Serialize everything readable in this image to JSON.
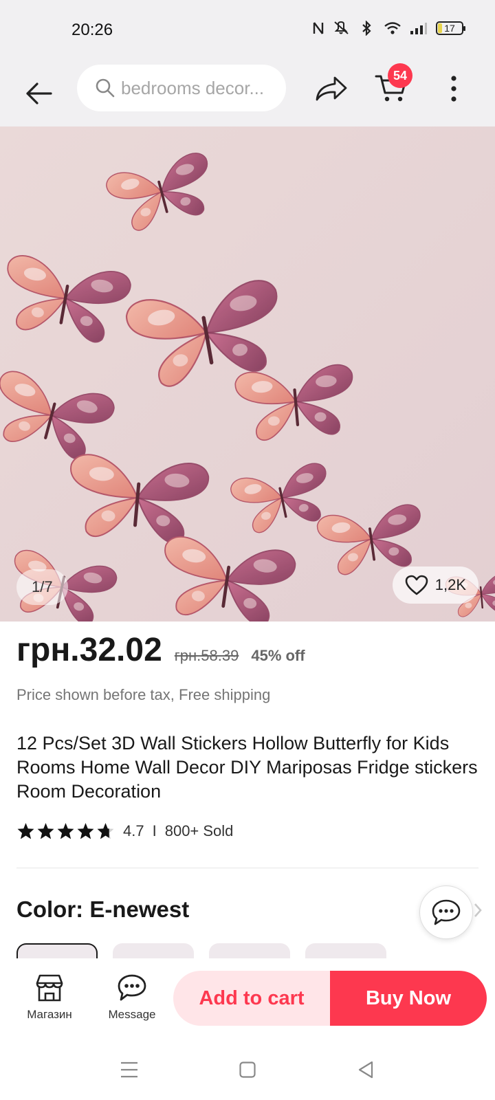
{
  "status_bar": {
    "time": "20:26",
    "battery": "17",
    "icons": [
      "nfc-icon",
      "mute-icon",
      "bluetooth-icon",
      "wifi-icon",
      "signal-icon",
      "battery-icon"
    ]
  },
  "header": {
    "search_placeholder": "bedrooms decor...",
    "cart_count": "54"
  },
  "gallery": {
    "counter": "1/7",
    "wishlist_count": "1,2K"
  },
  "product": {
    "price": "грн.32.02",
    "original_price": "грн.58.39",
    "discount": "45% off",
    "tax_note": "Price shown before tax, Free shipping",
    "title": "12 Pcs/Set 3D Wall Stickers Hollow Butterfly for Kids Rooms Home Wall Decor DIY Mariposas Fridge stickers Room Decoration",
    "rating": "4.7",
    "rating_stars": 4.7,
    "separator": "I",
    "sold": "800+ Sold",
    "color_label": "Color: E-newest"
  },
  "action_bar": {
    "store_label": "Магазин",
    "message_label": "Message",
    "add_to_cart": "Add to cart",
    "buy_now": "Buy Now"
  },
  "colors": {
    "accent": "#fd384f",
    "accent_light": "#ffe5e8",
    "header_bg": "#f1f0f2"
  }
}
